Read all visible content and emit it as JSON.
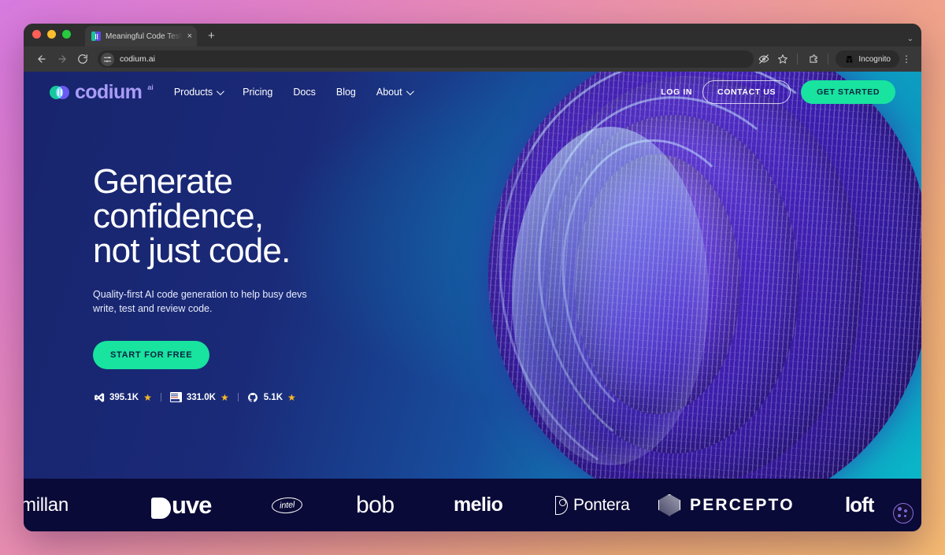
{
  "browser": {
    "tab": {
      "title": "Meaningful Code Tests for Bu",
      "close_label": "×",
      "favicon_name": "codium-favicon"
    },
    "new_tab_label": "+",
    "traffic_lights": [
      "close",
      "minimize",
      "zoom"
    ],
    "nav": {
      "back": "←",
      "forward": "→",
      "reload": "↻"
    },
    "omnibox": {
      "url": "codium.ai",
      "site_icon_name": "site-settings-icon"
    },
    "toolbar_icons": [
      "eye-off-icon",
      "bookmark-star-icon",
      "extensions-icon"
    ],
    "incognito_label": "Incognito",
    "menu_label": "⋮",
    "tabstrip_menu_label": "⌄"
  },
  "site": {
    "logo": {
      "text": "codium",
      "superscript": "ai"
    },
    "nav_links": [
      {
        "label": "Products",
        "has_chevron": true
      },
      {
        "label": "Pricing",
        "has_chevron": false
      },
      {
        "label": "Docs",
        "has_chevron": false
      },
      {
        "label": "Blog",
        "has_chevron": false
      },
      {
        "label": "About",
        "has_chevron": true
      }
    ],
    "login_label": "LOG IN",
    "contact_label": "CONTACT US",
    "get_started_label": "GET STARTED"
  },
  "hero": {
    "headline_line1": "Generate",
    "headline_line2": "confidence,",
    "headline_line3": "not just code.",
    "subtitle": "Quality-first AI code generation to help busy devs write, test and review code.",
    "cta_label": "START FOR FREE",
    "stats": [
      {
        "icon": "vscode-icon",
        "value": "395.1K",
        "star": "★"
      },
      {
        "icon": "jetbrains-icon",
        "value": "331.0K",
        "star": "★"
      },
      {
        "icon": "github-icon",
        "value": "5.1K",
        "star": "★"
      }
    ]
  },
  "logo_bar": {
    "logos": [
      {
        "name": "macmillan",
        "text": "millan"
      },
      {
        "name": "duve",
        "text": "uve"
      },
      {
        "name": "intel",
        "text": "intel"
      },
      {
        "name": "bob",
        "text": "bob"
      },
      {
        "name": "melio",
        "text": "melio"
      },
      {
        "name": "pontera",
        "text": "Pontera"
      },
      {
        "name": "percepto",
        "text": "PERCEPTO"
      },
      {
        "name": "loft",
        "text": "loft"
      }
    ]
  },
  "widgets": {
    "cookie_label": "cookie-settings"
  },
  "colors": {
    "accent_green": "#18e39f",
    "logo_purple": "#a99cf7",
    "star_gold": "#fdbb22",
    "logobar_bg": "#0a0a38"
  }
}
